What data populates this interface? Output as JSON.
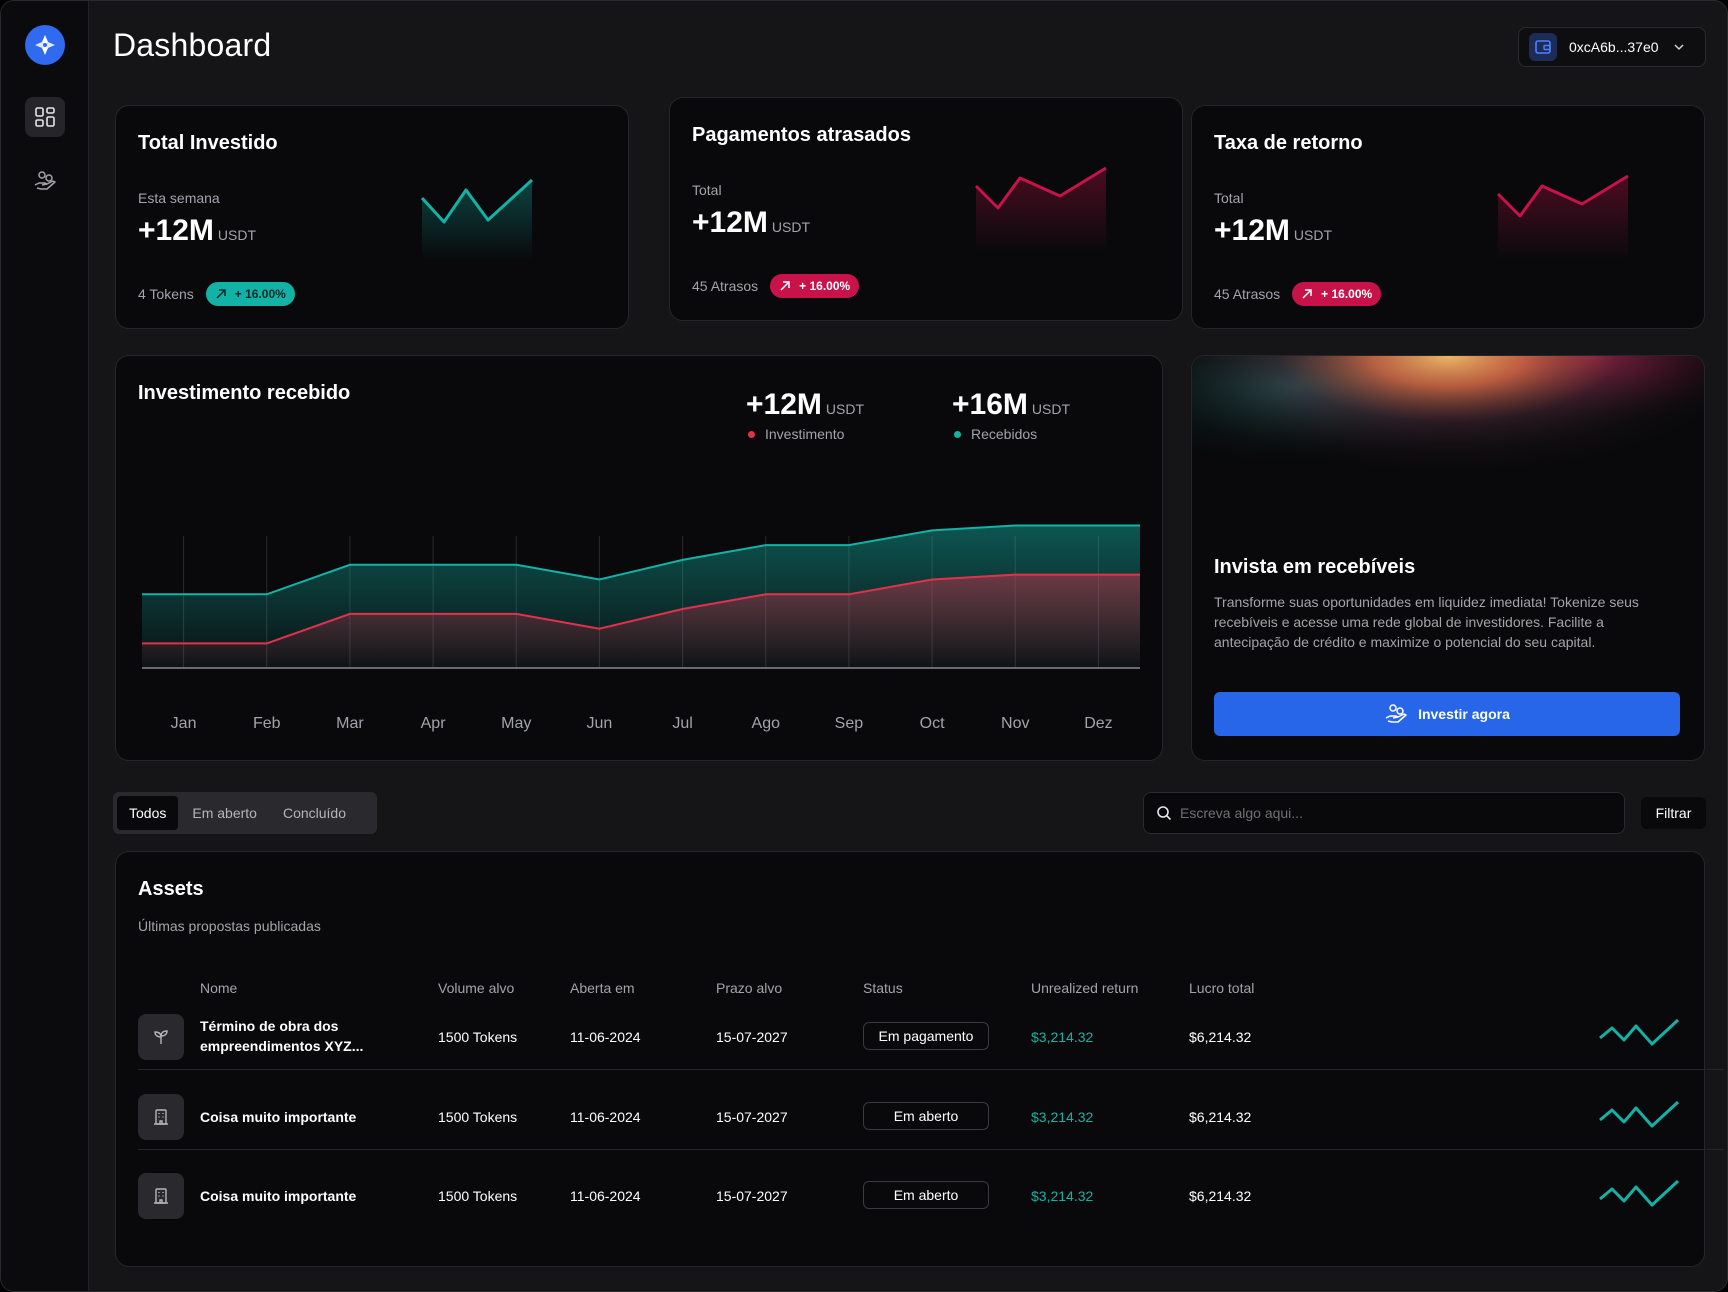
{
  "header": {
    "title": "Dashboard",
    "wallet_address": "0xcA6b...37e0"
  },
  "sidebar": {
    "items": [
      {
        "icon": "grid-icon",
        "active": true
      },
      {
        "icon": "hand-coins-icon",
        "active": false
      }
    ]
  },
  "cards": [
    {
      "title": "Total Investido",
      "label": "Esta semana",
      "value": "+12M",
      "unit": "USDT",
      "footer": "4 Tokens",
      "badge": "+ 16.00%",
      "color": "#12b3a6"
    },
    {
      "title": "Pagamentos atrasados",
      "label": "Total",
      "value": "+12M",
      "unit": "USDT",
      "footer": "45 Atrasos",
      "badge": "+ 16.00%",
      "color": "#c8124a"
    },
    {
      "title": "Taxa de retorno",
      "label": "Total",
      "value": "+12M",
      "unit": "USDT",
      "footer": "45 Atrasos",
      "badge": "+ 16.00%",
      "color": "#c8124a"
    }
  ],
  "investment_chart": {
    "title": "Investimento recebido",
    "legend": [
      {
        "value": "+12M",
        "unit": "USDT",
        "label": "Investimento",
        "color": "#e2314d"
      },
      {
        "value": "+16M",
        "unit": "USDT",
        "label": "Recebidos",
        "color": "#12b3a6"
      }
    ]
  },
  "chart_data": {
    "type": "area",
    "title": "Investimento recebido",
    "categories": [
      "Jan",
      "Feb",
      "Mar",
      "Apr",
      "May",
      "Jun",
      "Jul",
      "Ago",
      "Sep",
      "Oct",
      "Nov",
      "Dez"
    ],
    "series": [
      {
        "name": "Recebidos",
        "color": "#12b3a6",
        "values": [
          30,
          30,
          42,
          42,
          42,
          36,
          44,
          50,
          50,
          56,
          58,
          58
        ]
      },
      {
        "name": "Investimento",
        "color": "#e2314d",
        "values": [
          10,
          10,
          22,
          22,
          22,
          16,
          24,
          30,
          30,
          36,
          38,
          38
        ]
      }
    ],
    "ylim": [
      0,
      70
    ],
    "grid": "vertical"
  },
  "promo": {
    "title": "Invista em recebíveis",
    "text": "Transforme suas oportunidades em liquidez imediata! Tokenize seus recebíveis e acesse uma rede global de investidores. Facilite a antecipação de crédito e maximize o potencial do seu capital.",
    "button": "Investir agora"
  },
  "filters": {
    "tabs": [
      "Todos",
      "Em aberto",
      "Concluído"
    ],
    "active_tab": "Todos",
    "search_placeholder": "Escreva algo aqui...",
    "filter_button": "Filtrar"
  },
  "assets": {
    "title": "Assets",
    "subtitle": "Últimas propostas publicadas",
    "columns": [
      "Nome",
      "Volume alvo",
      "Aberta em",
      "Prazo alvo",
      "Status",
      "Unrealized return",
      "Lucro total"
    ],
    "rows": [
      {
        "icon": "sprout-icon",
        "name": "Término de obra dos empreendimentos XYZ...",
        "volume": "1500 Tokens",
        "opened": "11-06-2024",
        "deadline": "15-07-2027",
        "status": "Em pagamento",
        "unrealized": "$3,214.32",
        "profit": "$6,214.32"
      },
      {
        "icon": "building-icon",
        "name": "Coisa muito importante",
        "volume": "1500 Tokens",
        "opened": "11-06-2024",
        "deadline": "15-07-2027",
        "status": "Em aberto",
        "unrealized": "$3,214.32",
        "profit": "$6,214.32"
      },
      {
        "icon": "building-icon",
        "name": "Coisa muito importante",
        "volume": "1500 Tokens",
        "opened": "11-06-2024",
        "deadline": "15-07-2027",
        "status": "Em aberto",
        "unrealized": "$3,214.32",
        "profit": "$6,214.32"
      }
    ]
  }
}
